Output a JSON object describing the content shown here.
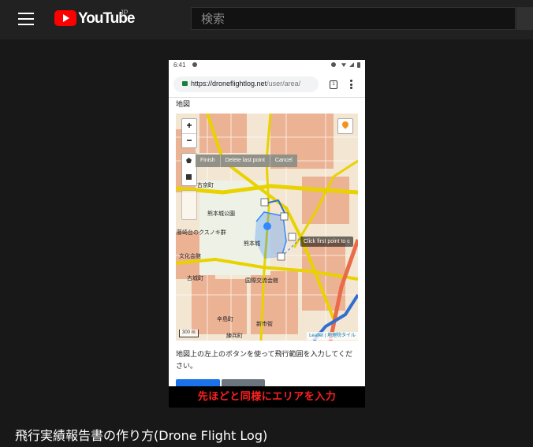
{
  "header": {
    "logo_text": "YouTube",
    "logo_region": "JP",
    "search_placeholder": "検索",
    "menu_icon": "hamburger-icon"
  },
  "video": {
    "status_time": "6:41",
    "url_domain": "https://droneflightlog.net",
    "url_path": "/user/area/",
    "tab_count": "1",
    "map_label": "地図",
    "map_controls": {
      "zoom_in": "+",
      "zoom_out": "−",
      "finish": "Finish",
      "delete_last": "Delete last point",
      "cancel": "Cancel"
    },
    "tooltip": "Click first point to c",
    "scale_label": "300 m",
    "attribution": "Leaflet | 地理院タイル",
    "place_names": [
      "熊本城公園",
      "古京町",
      "藤崎台のクスノキ群",
      "文化会館",
      "熊本城",
      "国際交流会館",
      "新市街",
      "古城町",
      "辛島町",
      "練兵町"
    ],
    "instructions": "地図上の左上のボタンを使って飛行範囲を入力してください。",
    "caption": "先ほどと同様にエリアを入力"
  },
  "video_title": "飛行実績報告書の作り方(Drone Flight Log)",
  "colors": {
    "page_bg": "#181818",
    "header_bg": "#212121",
    "brand_red": "#ff0000",
    "caption_red": "#ff2020",
    "polygon_blue": "#3388ff"
  }
}
